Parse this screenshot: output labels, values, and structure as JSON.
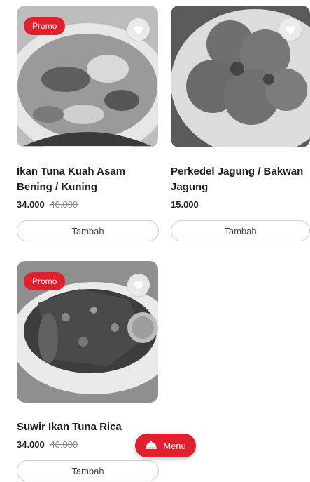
{
  "items": [
    {
      "promo": "Promo",
      "title": "Ikan Tuna Kuah Asam Bening / Kuning",
      "price": "34.000",
      "old_price": "40.000",
      "button": "Tambah",
      "favorite_icon": "heart-icon"
    },
    {
      "promo": "",
      "title": "Perkedel Jagung / Bakwan Jagung",
      "price": "15.000",
      "old_price": "",
      "button": "Tambah",
      "favorite_icon": "heart-icon"
    },
    {
      "promo": "Promo",
      "title": "Suwir Ikan Tuna Rica",
      "price": "34.000",
      "old_price": "40.000",
      "button": "Tambah",
      "favorite_icon": "heart-icon"
    }
  ],
  "fab": {
    "label": "Menu",
    "icon": "cloche-icon"
  },
  "colors": {
    "accent": "#e0202e",
    "card_border": "#cfcfcf"
  }
}
